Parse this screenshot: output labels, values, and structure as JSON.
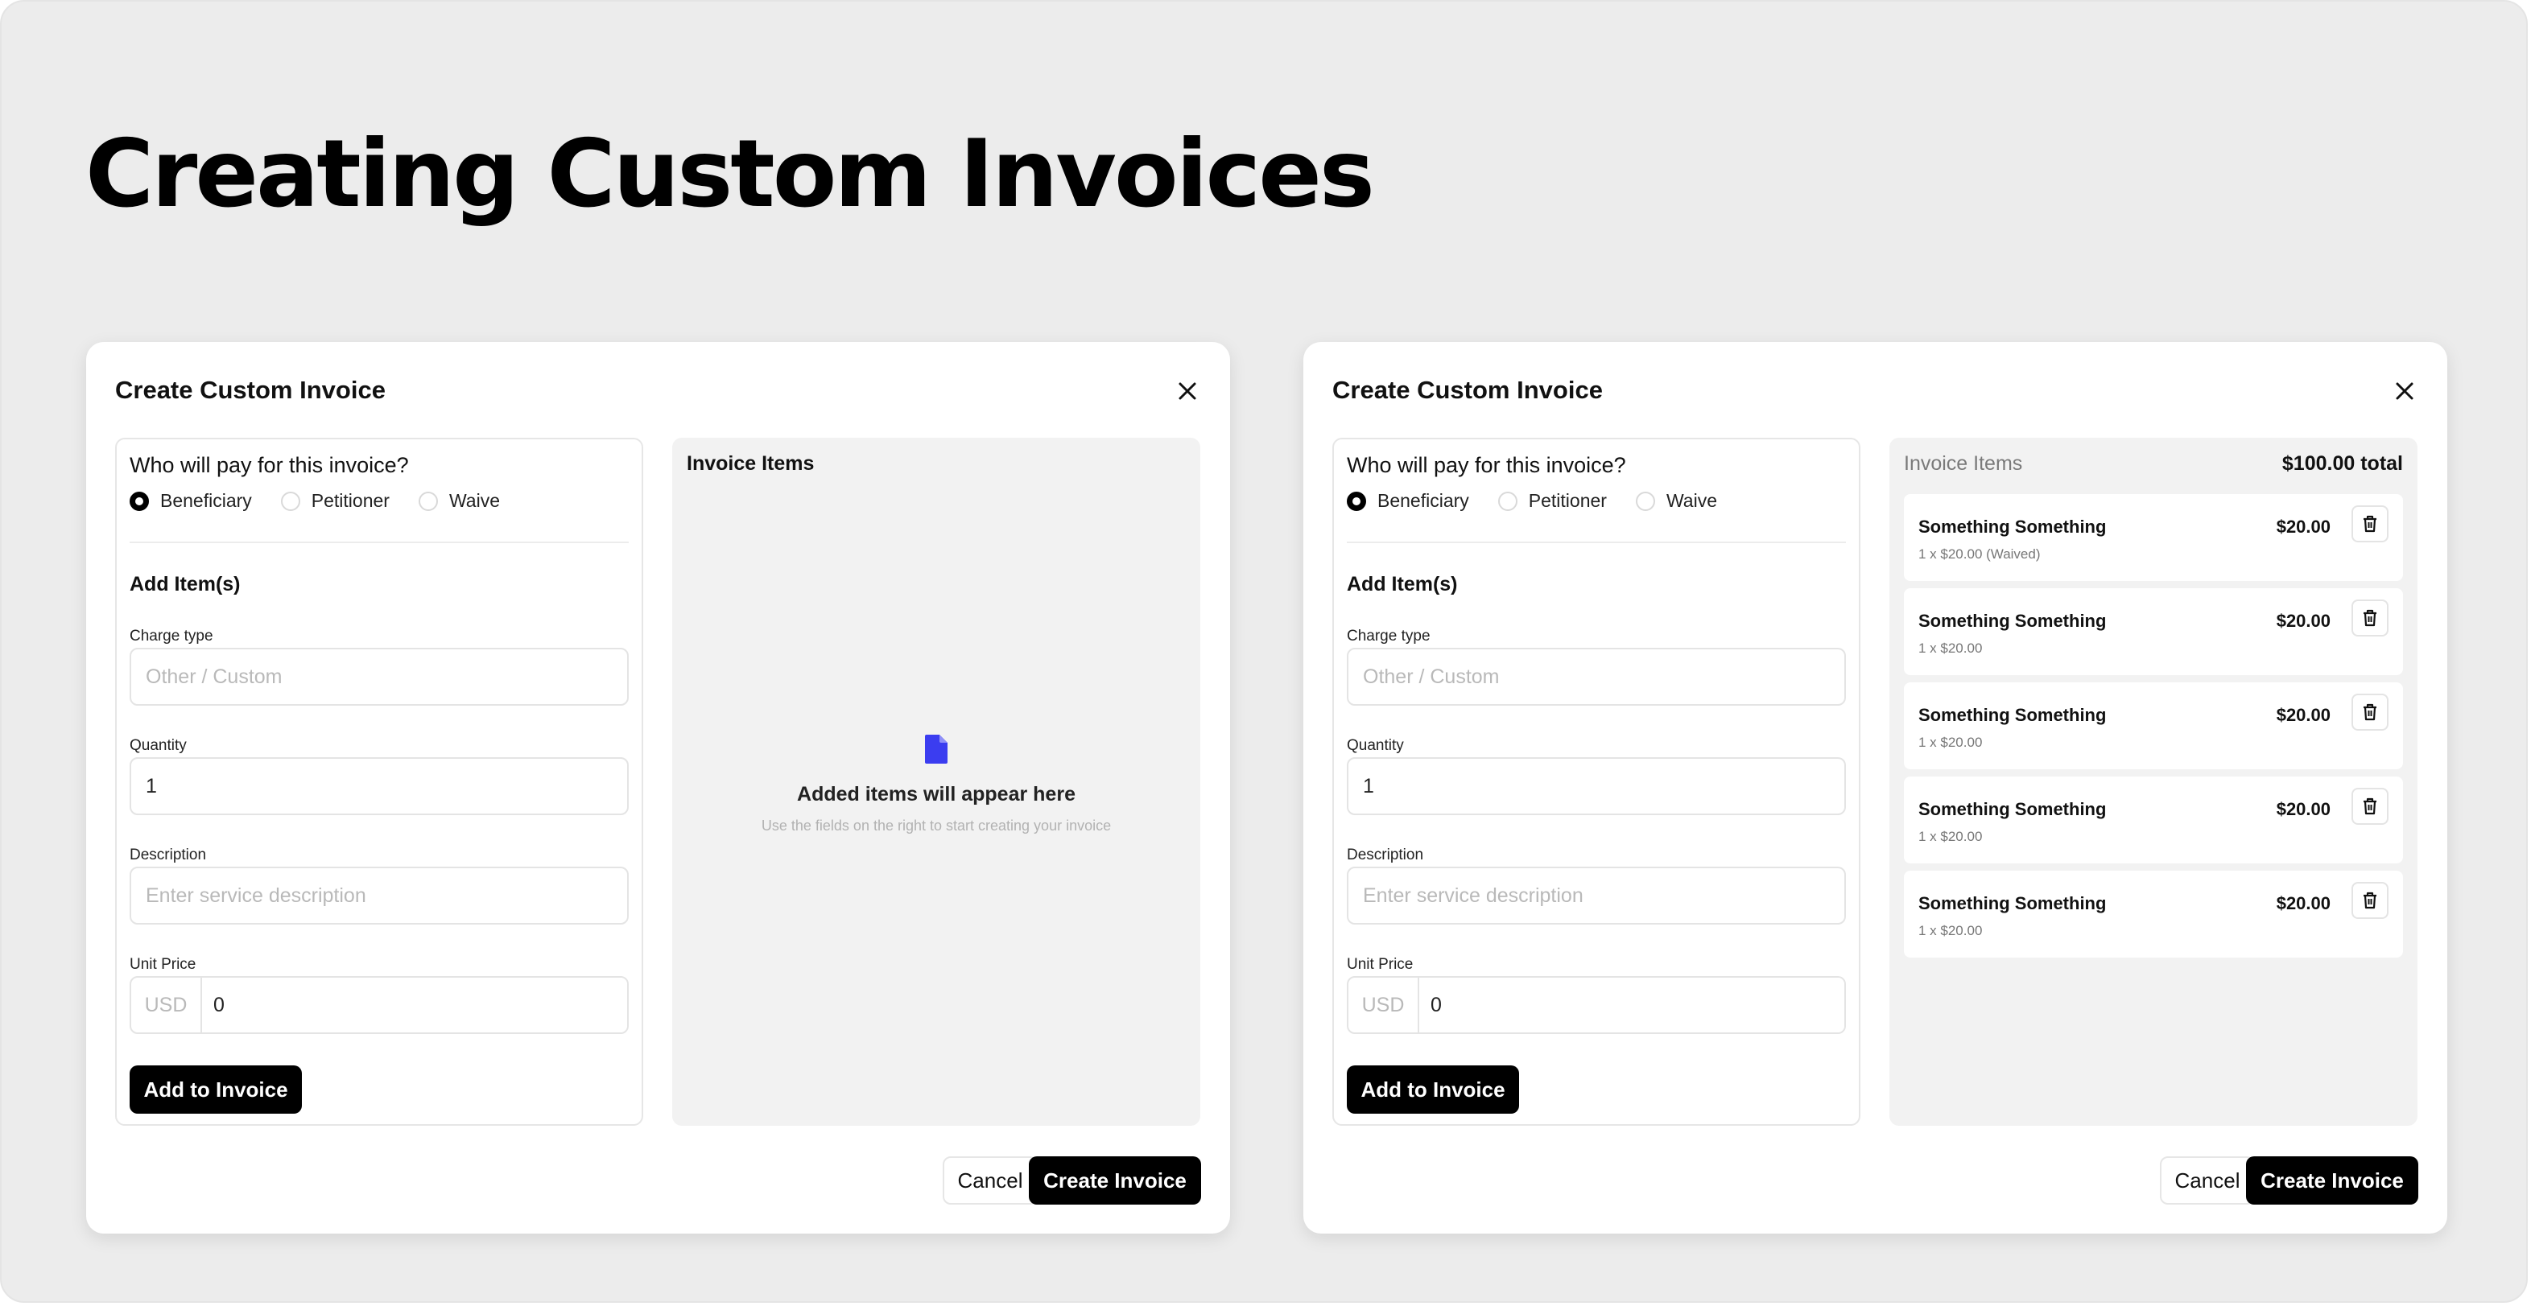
{
  "page": {
    "title": "Creating Custom Invoices"
  },
  "modals": [
    {
      "title": "Create Custom Invoice",
      "close_icon": "close-icon",
      "payer_question": "Who will pay for this invoice?",
      "payer_options": [
        "Beneficiary",
        "Petitioner",
        "Waive"
      ],
      "payer_selected": "Beneficiary",
      "add_items_heading": "Add Item(s)",
      "charge_type": {
        "label": "Charge type",
        "placeholder": "Other / Custom",
        "value": ""
      },
      "quantity": {
        "label": "Quantity",
        "value": "1"
      },
      "description": {
        "label": "Description",
        "placeholder": "Enter service description",
        "value": ""
      },
      "unit_price": {
        "label": "Unit Price",
        "currency": "USD",
        "value": "0"
      },
      "add_button": "Add to Invoice",
      "invoice_items": {
        "heading": "Invoice Items",
        "empty_icon": "document-icon",
        "empty_title": "Added items will appear here",
        "empty_subtitle": "Use the fields on the right to start creating your invoice"
      },
      "cancel_button": "Cancel",
      "create_button": "Create Invoice"
    },
    {
      "title": "Create Custom Invoice",
      "close_icon": "close-icon",
      "payer_question": "Who will pay for this invoice?",
      "payer_options": [
        "Beneficiary",
        "Petitioner",
        "Waive"
      ],
      "payer_selected": "Beneficiary",
      "add_items_heading": "Add Item(s)",
      "charge_type": {
        "label": "Charge type",
        "placeholder": "Other / Custom",
        "value": ""
      },
      "quantity": {
        "label": "Quantity",
        "value": "1"
      },
      "description": {
        "label": "Description",
        "placeholder": "Enter service description",
        "value": ""
      },
      "unit_price": {
        "label": "Unit Price",
        "currency": "USD",
        "value": "0"
      },
      "add_button": "Add to Invoice",
      "invoice_items": {
        "heading": "Invoice Items",
        "total": "$100.00 total",
        "delete_icon": "trash-icon",
        "items": [
          {
            "name": "Something Something",
            "detail": "1 x $20.00 (Waived)",
            "amount": "$20.00"
          },
          {
            "name": "Something Something",
            "detail": "1 x $20.00",
            "amount": "$20.00"
          },
          {
            "name": "Something Something",
            "detail": "1 x $20.00",
            "amount": "$20.00"
          },
          {
            "name": "Something Something",
            "detail": "1 x $20.00",
            "amount": "$20.00"
          },
          {
            "name": "Something Something",
            "detail": "1 x $20.00",
            "amount": "$20.00"
          }
        ]
      },
      "cancel_button": "Cancel",
      "create_button": "Create Invoice"
    }
  ],
  "colors": {
    "accent_document_icon": "#3b3df0",
    "primary_button": "#000000",
    "background": "#ececec"
  }
}
